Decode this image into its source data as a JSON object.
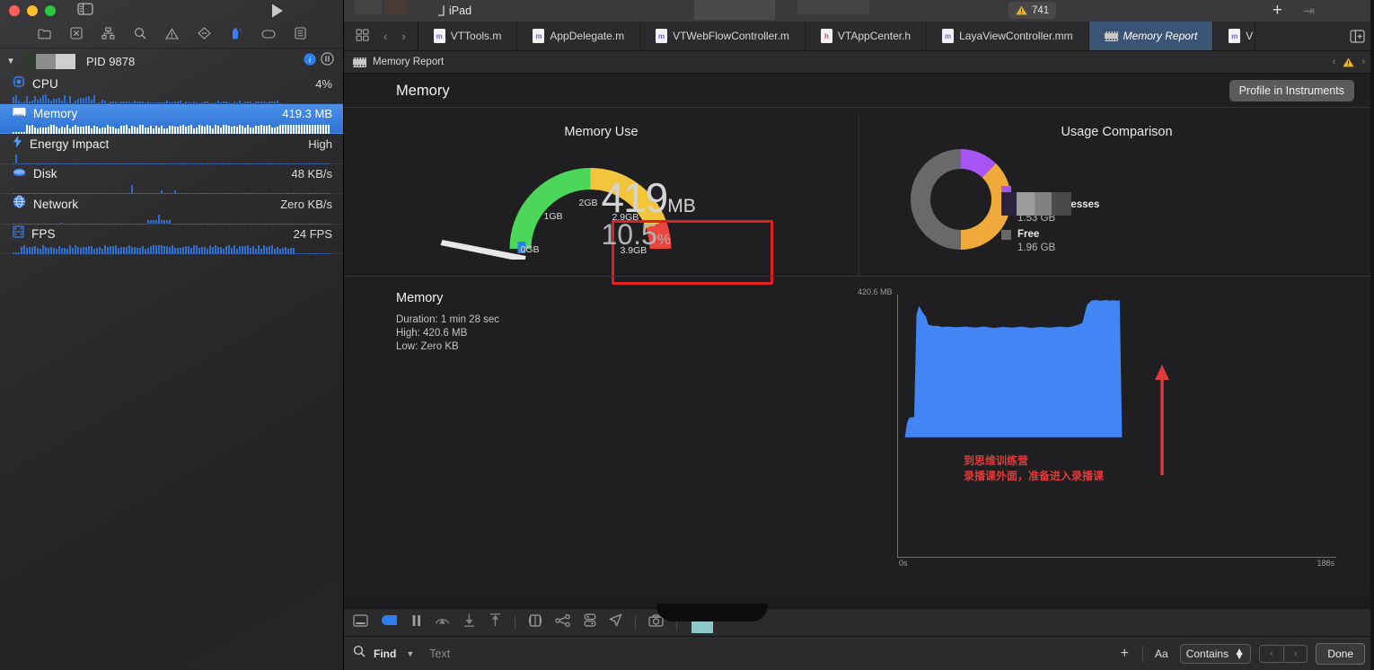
{
  "window": {
    "traffic_lights": [
      "close",
      "minimize",
      "zoom"
    ],
    "device_label": "iPad",
    "warning_count": "741"
  },
  "debug_navigator": {
    "toolbar_icons": [
      "folder-icon",
      "issue-icon",
      "hierarchy-icon",
      "search-icon",
      "warning-icon",
      "breakpoint-icon",
      "debug-gauge-icon",
      "tag-icon",
      "report-icon"
    ],
    "process": {
      "label": "PID 9878",
      "redacted_app_name": true
    },
    "metrics": [
      {
        "name": "CPU",
        "value": "4%",
        "selected": false,
        "icon": "cpu-icon"
      },
      {
        "name": "Memory",
        "value": "419.3 MB",
        "selected": true,
        "icon": "memory-icon"
      },
      {
        "name": "Energy Impact",
        "value": "High",
        "selected": false,
        "icon": "bolt-icon"
      },
      {
        "name": "Disk",
        "value": "48 KB/s",
        "selected": false,
        "icon": "disk-icon"
      },
      {
        "name": "Network",
        "value": "Zero KB/s",
        "selected": false,
        "icon": "globe-icon"
      },
      {
        "name": "FPS",
        "value": "24 FPS",
        "selected": false,
        "icon": "film-icon"
      }
    ]
  },
  "editor": {
    "tabs": [
      {
        "label": "VTTools.m",
        "kind": "m",
        "active": false
      },
      {
        "label": "AppDelegate.m",
        "kind": "m",
        "active": false
      },
      {
        "label": "VTWebFlowController.m",
        "kind": "m",
        "active": false
      },
      {
        "label": "VTAppCenter.h",
        "kind": "h",
        "active": false
      },
      {
        "label": "LayaViewController.mm",
        "kind": "m",
        "active": false
      },
      {
        "label": "Memory Report",
        "kind": "film",
        "active": true
      },
      {
        "label": "V",
        "kind": "m",
        "active": false
      }
    ],
    "breadcrumb": "Memory Report"
  },
  "report": {
    "title": "Memory",
    "profile_button": "Profile in Instruments",
    "memory_use": {
      "panel_title": "Memory Use",
      "value_number": "419",
      "value_unit": "MB",
      "percent_number": "10.5",
      "percent_unit": "%",
      "gauge_ticks": [
        "0GB",
        "1GB",
        "2GB",
        "2.9GB",
        "3.9GB"
      ],
      "highlight_color": "#e02020",
      "arc_colors": {
        "green": "#4cd75a",
        "yellow": "#f2c53d",
        "red": "#e8453c"
      }
    },
    "usage_comparison": {
      "panel_title": "Usage Comparison",
      "legend": [
        {
          "name": "",
          "value": "",
          "color": "#a855f7",
          "redacted": true
        },
        {
          "name": "Other Processes",
          "value": "1.53 GB",
          "color": "#f0a93b",
          "redacted": false
        },
        {
          "name": "Free",
          "value": "1.96 GB",
          "color": "#69696b",
          "redacted": false
        }
      ]
    }
  },
  "chart_data": {
    "type": "area",
    "title": "Memory",
    "xlabel": "",
    "ylabel": "",
    "x_ticks": [
      "0s",
      "188s"
    ],
    "y_ticks": [
      "420.6 MB"
    ],
    "ylim": [
      0,
      420.6
    ],
    "xlim": [
      0,
      188
    ],
    "grid": false,
    "legend_position": "none",
    "series_color": "#4285f4",
    "info_lines": [
      "Duration: 1 min 28 sec",
      "High: 420.6 MB",
      "Low: Zero KB"
    ],
    "series": [
      {
        "name": "Memory",
        "x": [
          0,
          1,
          2,
          3,
          4,
          5,
          6,
          7,
          8,
          9,
          10,
          12,
          14,
          16,
          18,
          22,
          26,
          30,
          34,
          38,
          42,
          46,
          50,
          54,
          58,
          62,
          66,
          70,
          72,
          74,
          76,
          78,
          80,
          82,
          84,
          86,
          88,
          89,
          90,
          91,
          92,
          93
        ],
        "values": [
          0,
          45,
          60,
          60,
          62,
          370,
          396,
          386,
          372,
          365,
          340,
          336,
          336,
          333,
          334,
          332,
          334,
          331,
          334,
          330,
          333,
          331,
          334,
          330,
          333,
          331,
          334,
          332,
          335,
          339,
          345,
          400,
          413,
          414,
          412,
          414,
          412,
          414,
          413,
          412,
          414,
          0
        ]
      }
    ],
    "annotation": {
      "text_line1": "到思维训练营",
      "text_line2": "录播课外面，准备进入录播课",
      "color": "#e03a3a",
      "arrow": "up-arrow-annotation"
    }
  },
  "debug_toolbar": {
    "icons": [
      "console-toggle-icon",
      "debug-area-icon",
      "pause-icon",
      "step-over-icon",
      "step-into-icon",
      "step-out-icon",
      "view-hierarchy-icon",
      "memory-graph-icon",
      "environment-overrides-icon",
      "location-icon",
      "screenshot-icon"
    ]
  },
  "find_bar": {
    "label": "Find",
    "placeholder": "Text",
    "value": "",
    "match_label": "Aa",
    "mode": "Contains",
    "done_label": "Done"
  }
}
